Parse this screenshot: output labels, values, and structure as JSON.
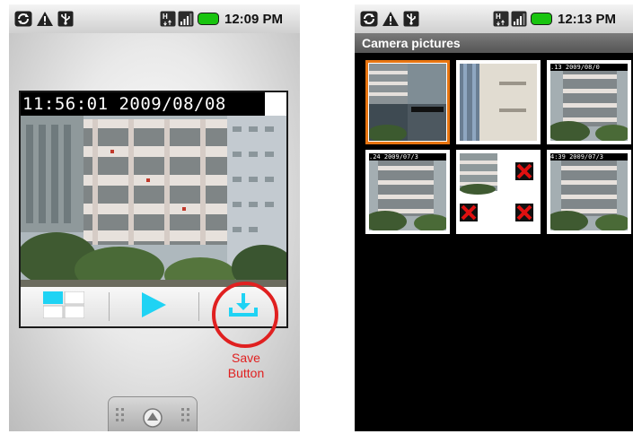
{
  "colors": {
    "accent": "#1fd3f4",
    "callout": "#e02020",
    "battery": "#19c40f",
    "selected_border": "#e87511"
  },
  "status_icons": [
    "sync-icon",
    "warning-icon",
    "usb-icon",
    "hsdpa-icon",
    "signal-icon",
    "battery-icon"
  ],
  "phone1": {
    "time": "12:09 PM",
    "player": {
      "timestamp": "11:56:01 2009/08/08",
      "controls": [
        "grid-view-icon",
        "play-icon",
        "download-icon"
      ]
    },
    "callout": {
      "line1": "Save",
      "line2": "Button"
    }
  },
  "phone2": {
    "time": "12:13 PM",
    "title": "Camera pictures",
    "thumbnails": [
      {
        "timestamp": "",
        "selected": true
      },
      {
        "timestamp": "",
        "selected": false
      },
      {
        "timestamp": ".13 2009/08/0",
        "selected": false
      },
      {
        "timestamp": ".24 2009/07/3",
        "selected": false
      },
      {
        "timestamp": "",
        "selected": false,
        "broken": true
      },
      {
        "timestamp": "4:39 2009/07/3",
        "selected": false
      }
    ]
  }
}
